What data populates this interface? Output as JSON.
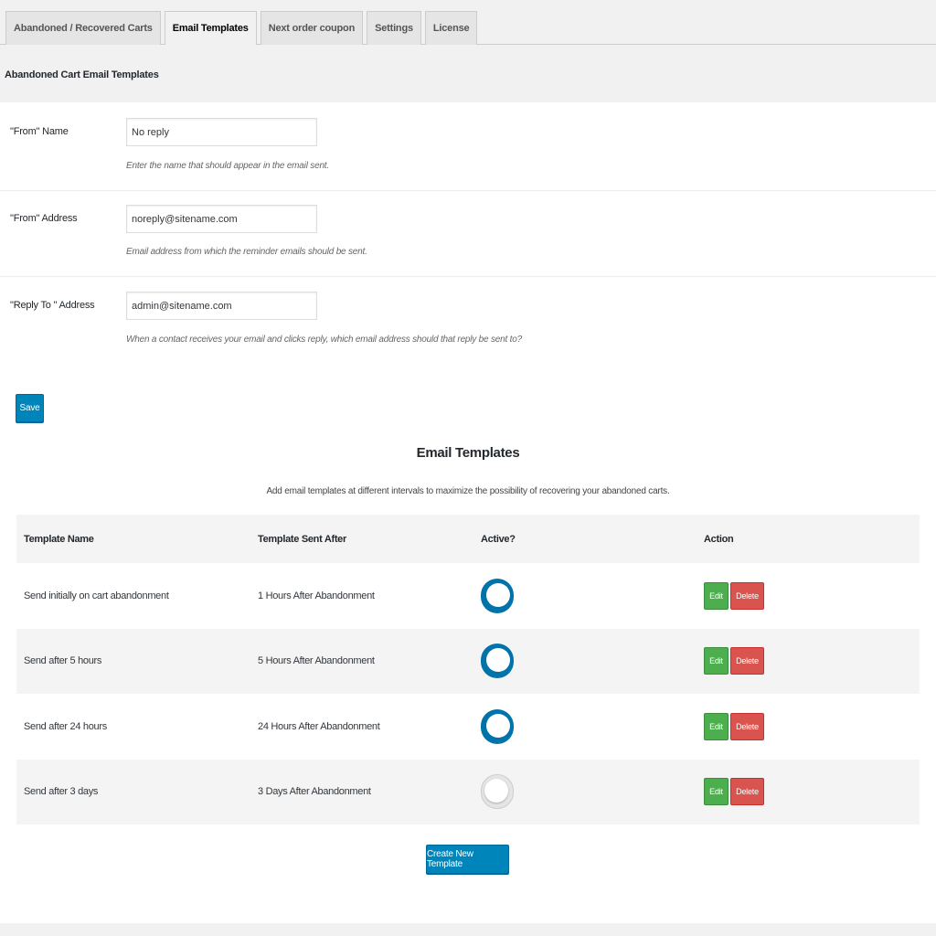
{
  "tabs": [
    {
      "label": "Abandoned / Recovered Carts",
      "active": false
    },
    {
      "label": "Email Templates",
      "active": true
    },
    {
      "label": "Next order coupon",
      "active": false
    },
    {
      "label": "Settings",
      "active": false
    },
    {
      "label": "License",
      "active": false
    }
  ],
  "section_title": "Abandoned Cart Email Templates",
  "form": {
    "from_name": {
      "label": "\"From\" Name",
      "value": "No reply",
      "description": "Enter the name that should appear in the email sent."
    },
    "from_address": {
      "label": "\"From\" Address",
      "value": "noreply@sitename.com",
      "description": "Email address from which the reminder emails should be sent."
    },
    "reply_to": {
      "label": "\"Reply To \" Address",
      "value": "admin@sitename.com",
      "description": "When a contact receives your email and clicks reply, which email address should that reply be sent to?"
    },
    "save_label": "Save"
  },
  "templates_section": {
    "title": "Email Templates",
    "subtitle": "Add email templates at different intervals to maximize the possibility of recovering your abandoned carts.",
    "columns": [
      "Template Name",
      "Template Sent After",
      "Active?",
      "Action"
    ],
    "rows": [
      {
        "name": "Send initially on cart abandonment",
        "sent_after": "1 Hours After Abandonment",
        "active": true,
        "edit": "Edit",
        "delete": "Delete"
      },
      {
        "name": "Send after 5 hours",
        "sent_after": "5 Hours After Abandonment",
        "active": true,
        "edit": "Edit",
        "delete": "Delete"
      },
      {
        "name": "Send after 24 hours",
        "sent_after": "24 Hours After Abandonment",
        "active": true,
        "edit": "Edit",
        "delete": "Delete"
      },
      {
        "name": "Send after 3 days",
        "sent_after": "3 Days After Abandonment",
        "active": false,
        "edit": "Edit",
        "delete": "Delete"
      }
    ],
    "create_label": "Create New Template"
  },
  "colors": {
    "primary": "#0085ba",
    "toggle_on": "#0073aa",
    "edit": "#4cae4c",
    "delete": "#d9534f"
  }
}
